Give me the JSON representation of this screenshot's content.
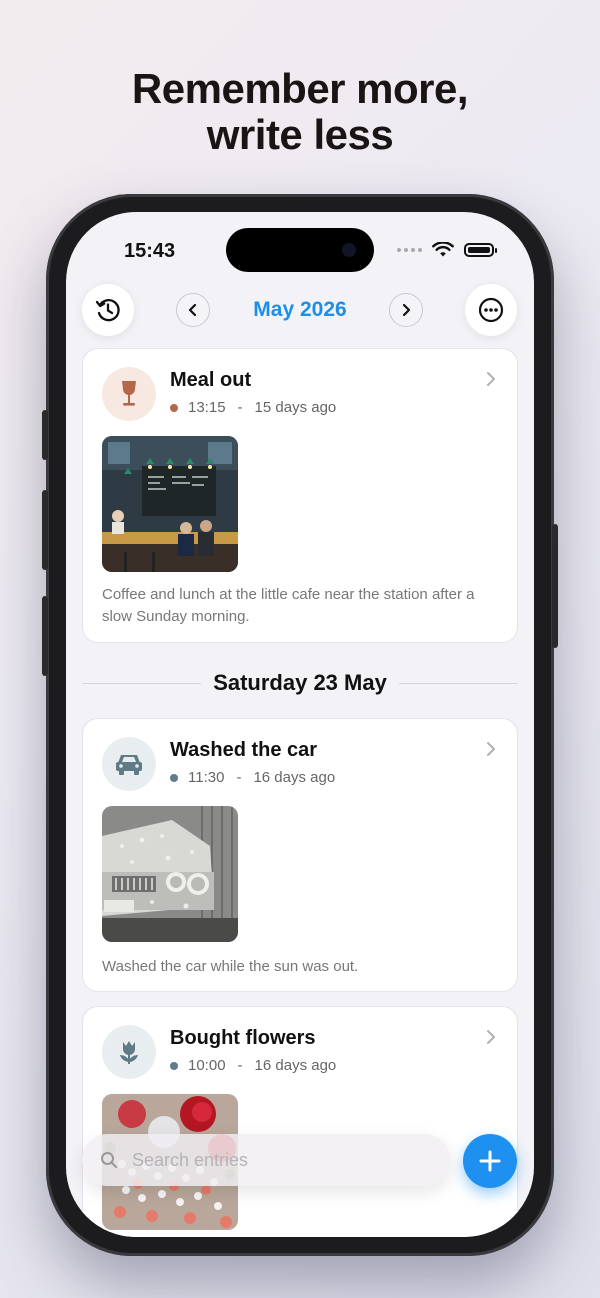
{
  "headline": {
    "line1": "Remember more,",
    "line2": "write less"
  },
  "status_bar": {
    "time": "15:43"
  },
  "nav": {
    "month": "May 2026"
  },
  "entries": [
    {
      "title": "Meal out",
      "time": "13:15",
      "separator": "-",
      "ago": "15 days ago",
      "icon": "wine-glass-icon",
      "accent": "#b5674a",
      "icon_bg": "#f7e8e2",
      "description": "Coffee and lunch at the little cafe near the station after a slow Sunday morning."
    },
    {
      "title": "Washed the car",
      "time": "11:30",
      "separator": "-",
      "ago": "16 days ago",
      "icon": "car-icon",
      "accent": "#5e7b86",
      "icon_bg": "#e8edef",
      "description": "Washed the car while the sun was out."
    },
    {
      "title": "Bought flowers",
      "time": "10:00",
      "separator": "-",
      "ago": "16 days ago",
      "icon": "tulip-icon",
      "accent": "#5e7b86",
      "icon_bg": "#e8edef"
    }
  ],
  "day_header": "Saturday 23 May",
  "search": {
    "placeholder": "Search entries"
  },
  "colors": {
    "accent": "#1e8fe6",
    "fab": "#1e90f0"
  }
}
